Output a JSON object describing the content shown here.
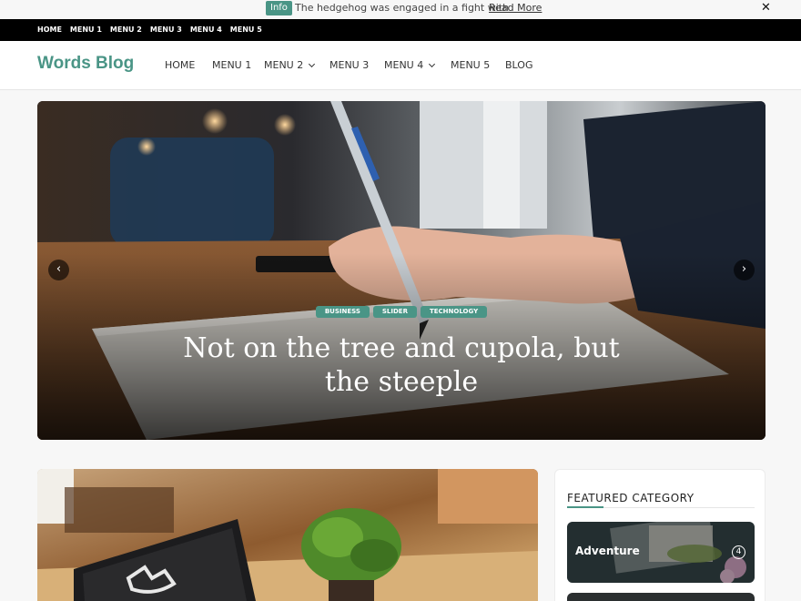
{
  "notice": {
    "tag": "Info",
    "message": "The hedgehog was engaged in a fight with",
    "link": "Read More",
    "close": "✕"
  },
  "topbar": {
    "items": [
      "HOME",
      "MENU 1",
      "MENU 2",
      "MENU 3",
      "MENU 4",
      "MENU 5"
    ]
  },
  "header": {
    "logo": "Words Blog",
    "nav": [
      {
        "label": "HOME",
        "dropdown": false
      },
      {
        "label": "MENU 1",
        "dropdown": false
      },
      {
        "label": "MENU 2",
        "dropdown": true
      },
      {
        "label": "MENU 3",
        "dropdown": false
      },
      {
        "label": "MENU 4",
        "dropdown": true
      },
      {
        "label": "MENU 5",
        "dropdown": false
      },
      {
        "label": "BLOG",
        "dropdown": false
      }
    ]
  },
  "slider": {
    "prev": "‹",
    "next": "›",
    "categories": [
      "BUSINESS",
      "SLIDER",
      "TECHNOLOGY"
    ],
    "title_line1": "Not on the tree and cupola, but",
    "title_line2": "the steeple"
  },
  "sidebar": {
    "heading": "FEATURED CATEGORY",
    "categories": [
      {
        "name": "Adventure",
        "count": "4"
      }
    ]
  },
  "colors": {
    "accent": "#4a9586",
    "topbar": "#000000"
  }
}
